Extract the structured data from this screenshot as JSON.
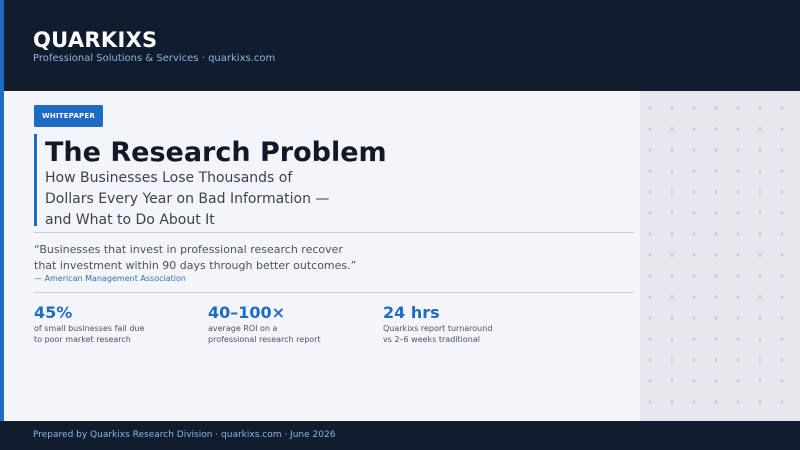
{
  "header": {
    "brand": "QUARKIXS",
    "tagline": "Professional Solutions & Services · quarkixs.com"
  },
  "badge": "WHITEPAPER",
  "title": "The Research Problem",
  "subtitle": "How Businesses Lose Thousands of Dollars Every Year on Bad Information — and What to Do About It",
  "quote": {
    "text": "“Businesses that invest in professional research recover  that investment within 90 days through better outcomes.”",
    "source": "— American Management Association"
  },
  "stats": [
    {
      "value": "45%",
      "desc": "of small businesses fail due to poor market research"
    },
    {
      "value": "40–100×",
      "desc": "average ROI on a professional research report"
    },
    {
      "value": "24 hrs",
      "desc": "Quarkixs report turnaround vs 2–6 weeks traditional"
    }
  ],
  "footer": "Prepared by Quarkixs Research Division · quarkixs.com · June 2026",
  "colors": {
    "accent": "#1e6bc4",
    "header_bg": "#111c2e",
    "card_bg": "#f4f5f8"
  }
}
